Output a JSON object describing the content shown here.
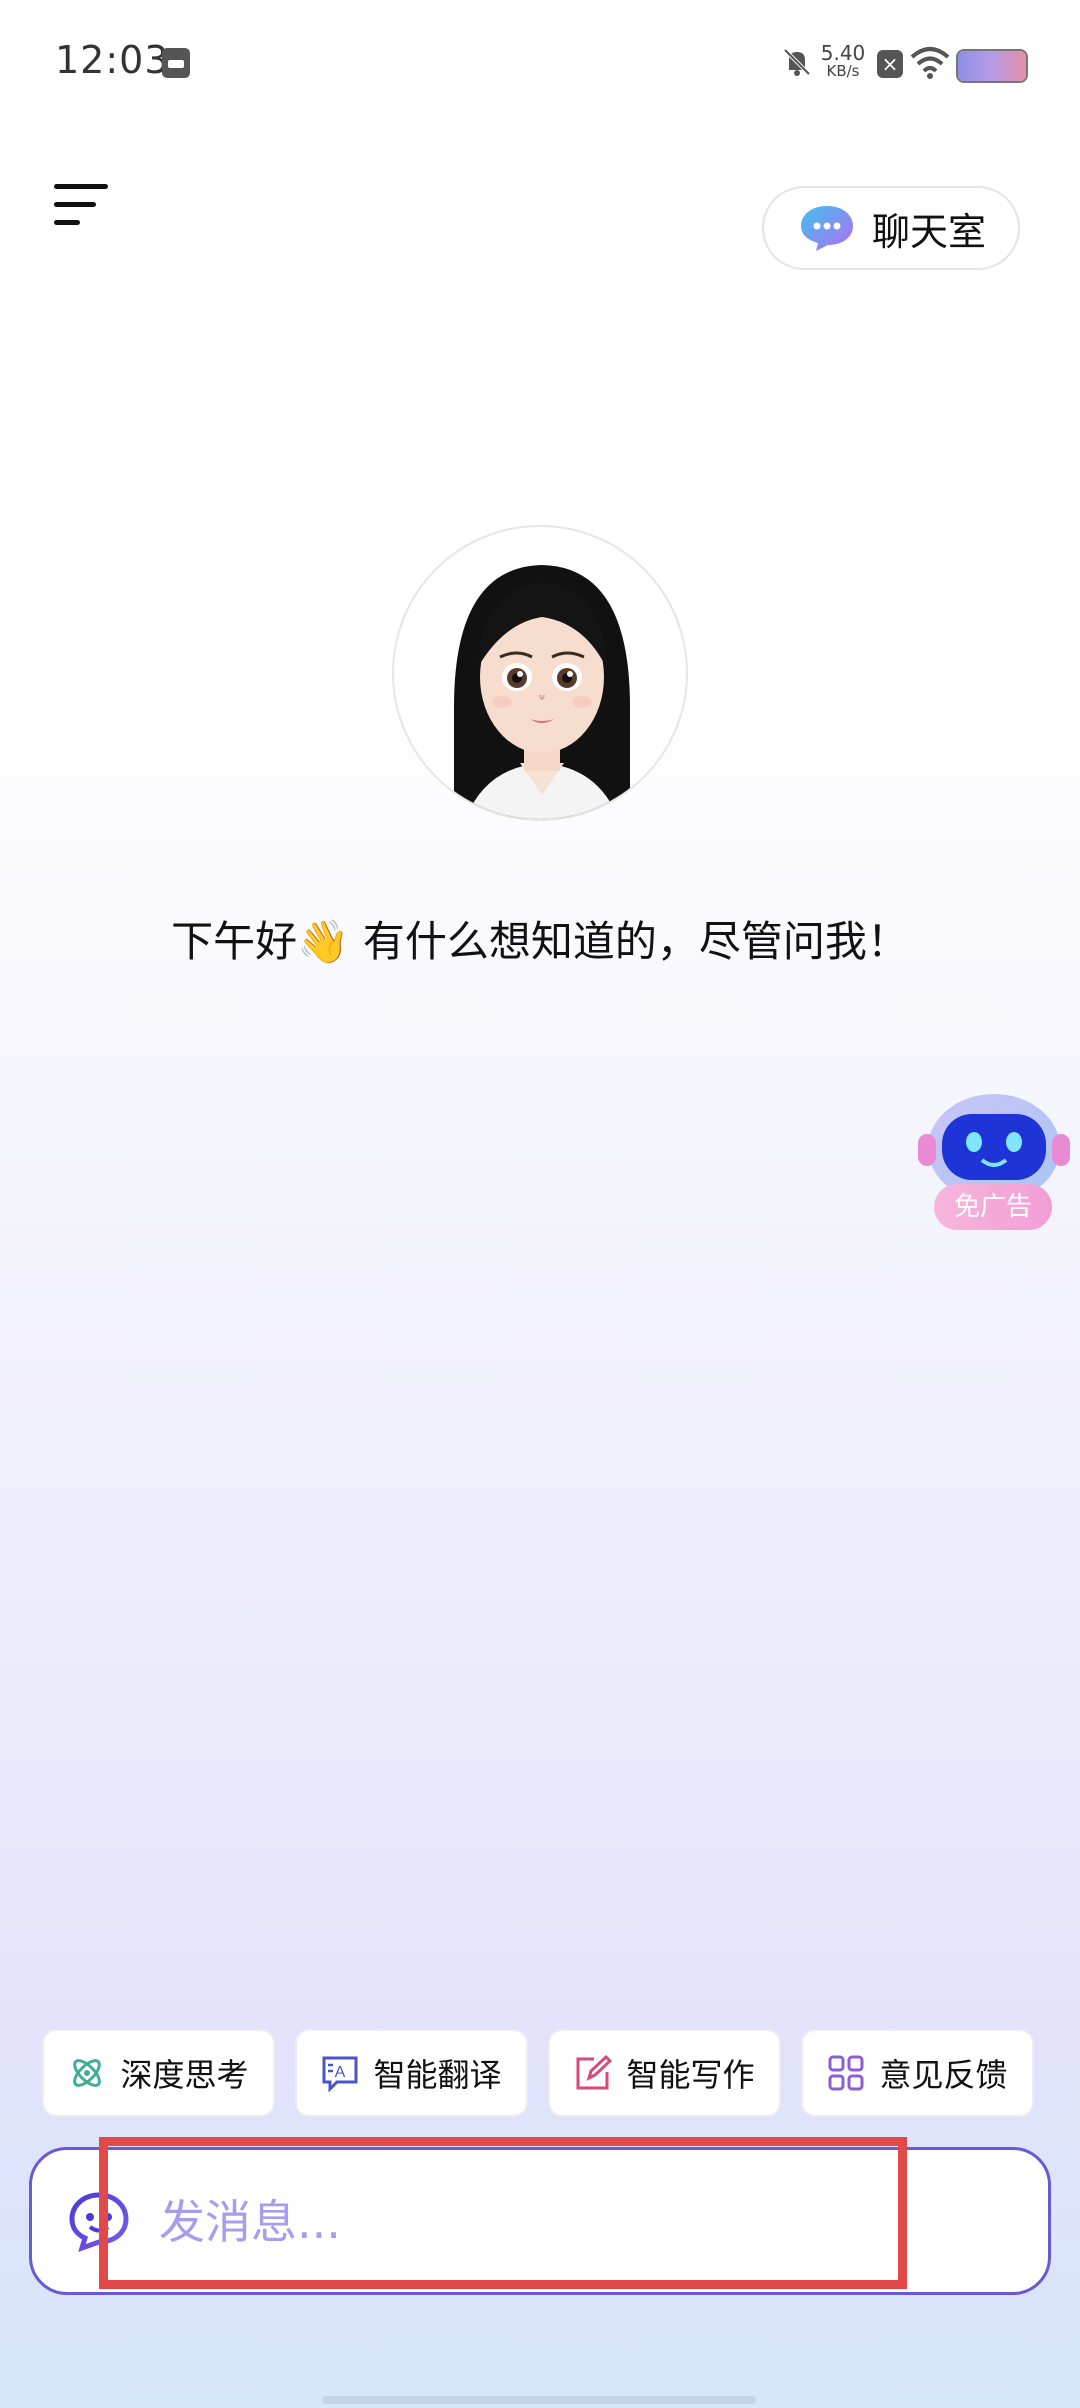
{
  "status_bar": {
    "time": "12:03",
    "net_speed_value": "5.40",
    "net_speed_unit": "KB/s",
    "icons": [
      "sim-icon",
      "mute-icon",
      "sim-off-icon",
      "wifi-icon",
      "battery-icon"
    ]
  },
  "header": {
    "menu_icon": "menu-icon",
    "chat_room_label": "聊天室",
    "chat_room_icon": "chat-bubble-icon"
  },
  "assistant": {
    "avatar": "cartoon-girl-avatar",
    "greeting": "下午好👋 有什么想知道的，尽管问我！"
  },
  "ad_widget": {
    "icon": "robot-icon",
    "label": "免广告"
  },
  "quick_actions": [
    {
      "label": "深度思考",
      "icon": "atom-icon",
      "color": "#3fae94"
    },
    {
      "label": "智能翻译",
      "icon": "translate-icon",
      "color": "#4a56c6"
    },
    {
      "label": "智能写作",
      "icon": "edit-icon",
      "color": "#d94a7a"
    },
    {
      "label": "意见反馈",
      "icon": "grid-icon",
      "color": "#8a5fd6"
    }
  ],
  "composer": {
    "icon": "chat-face-icon",
    "value": "",
    "placeholder": "发消息..."
  },
  "colors": {
    "accent": "#6b58d6",
    "placeholder": "#a99cef",
    "highlight": "#e24a4a"
  }
}
